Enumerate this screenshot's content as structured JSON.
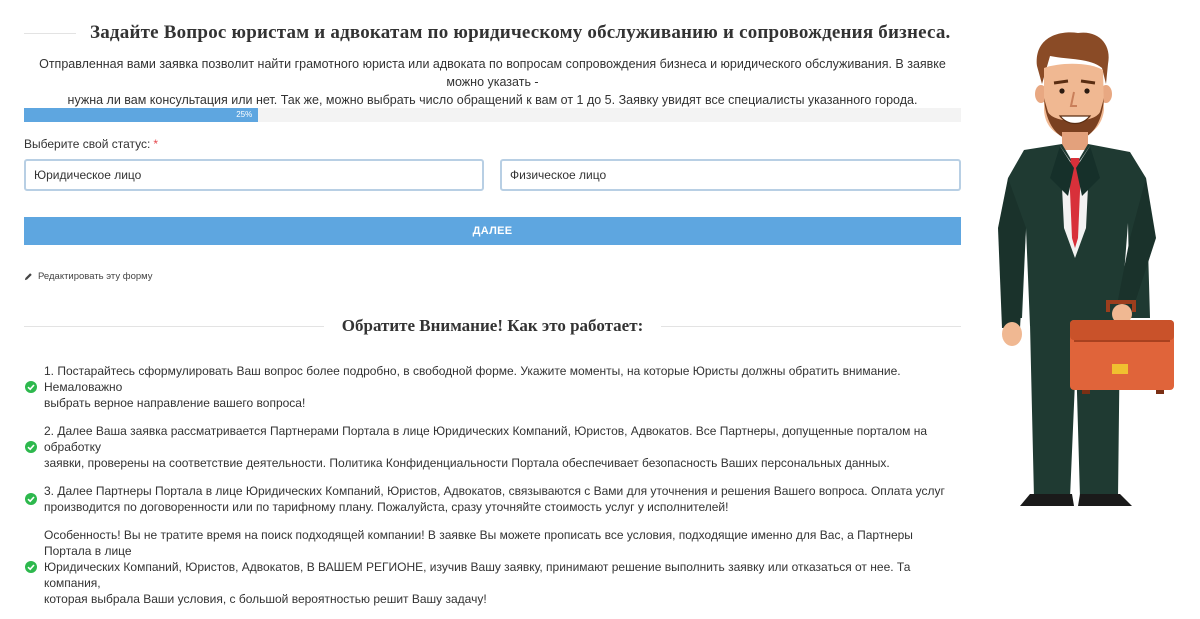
{
  "header": {
    "title": "Задайте Вопрос юристам и адвокатам по юридическому обслуживанию и сопровождения бизнеса.",
    "intro_line1": "Отправленная вами заявка позволит найти грамотного юриста или адвоката по вопросам сопровождения бизнеса и юридического обслуживания. В заявке можно указать -",
    "intro_line2": "нужна ли вам консультация или нет. Так же, можно выбрать число обращений к вам от 1 до 5. Заявку увидят все специалисты указанного города."
  },
  "progress": {
    "value": 0.25,
    "label": "25%",
    "color": "#5ea6e0"
  },
  "form": {
    "status_label": "Выберите свой статус:",
    "required_mark": "*",
    "options": [
      "Юридическое лицо",
      "Физическое лицо"
    ],
    "next_button": "ДАЛЕЕ",
    "edit_link": "Редактировать эту форму"
  },
  "info": {
    "title": "Обратите Внимание! Как это работает:",
    "items": [
      {
        "line1": "1. Постарайтесь сформулировать Ваш вопрос более подробно, в свободной форме. Укажите моменты, на которые Юристы должны обратить внимание. Немаловажно",
        "line2": "выбрать верное направление вашего вопроса!"
      },
      {
        "line1": "2. Далее Ваша заявка рассматривается Партнерами Портала в лице Юридических Компаний, Юристов, Адвокатов. Все Партнеры, допущенные порталом на обработку",
        "line2": "заявки, проверены на соответствие деятельности. Политика Конфиденциальности Портала обеспечивает безопасность Ваших персональных данных."
      },
      {
        "line1": "3. Далее Партнеры Портала в лице Юридических Компаний, Юристов, Адвокатов, связываются с Вами для уточнения и решения Вашего вопроса. Оплата услуг",
        "line2": "производится по договоренности или по тарифному плану. Пожалуйста, сразу уточняйте стоимость услуг у исполнителей!"
      },
      {
        "line1": "Особенность! Вы не тратите время на поиск подходящей компании! В заявке Вы можете прописать все условия, подходящие именно для Вас, а Партнеры Портала в лице",
        "line2": "Юридических Компаний, Юристов, Адвокатов, В ВАШЕМ РЕГИОНЕ, изучив Вашу заявку, принимают решение выполнить заявку или отказаться от нее. Та компания,",
        "line3": "которая выбрала Ваши условия, с большой вероятностью решит Вашу задачу!"
      }
    ]
  },
  "colors": {
    "accent": "#5ea6e0",
    "check": "#2db84d",
    "required": "#e5484d"
  },
  "icons": {
    "edit": "pencil-icon",
    "check": "check-circle-icon"
  }
}
